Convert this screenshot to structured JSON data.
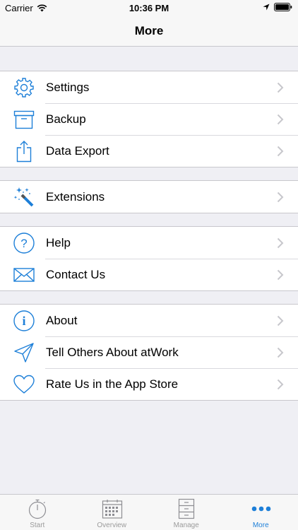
{
  "status_bar": {
    "carrier": "Carrier",
    "time": "10:36 PM"
  },
  "nav": {
    "title": "More"
  },
  "groups": [
    {
      "items": [
        {
          "label": "Settings",
          "icon": "gear-icon"
        },
        {
          "label": "Backup",
          "icon": "archive-box-icon"
        },
        {
          "label": "Data Export",
          "icon": "share-icon"
        }
      ]
    },
    {
      "items": [
        {
          "label": "Extensions",
          "icon": "magic-wand-icon"
        }
      ]
    },
    {
      "items": [
        {
          "label": "Help",
          "icon": "question-icon"
        },
        {
          "label": "Contact Us",
          "icon": "envelope-icon"
        }
      ]
    },
    {
      "items": [
        {
          "label": "About",
          "icon": "info-icon"
        },
        {
          "label": "Tell Others About atWork",
          "icon": "paper-plane-icon"
        },
        {
          "label": "Rate Us in the App Store",
          "icon": "heart-icon"
        }
      ]
    }
  ],
  "tabs": [
    {
      "label": "Start",
      "icon": "stopwatch-icon",
      "active": false
    },
    {
      "label": "Overview",
      "icon": "calendar-icon",
      "active": false
    },
    {
      "label": "Manage",
      "icon": "cabinet-icon",
      "active": false
    },
    {
      "label": "More",
      "icon": "more-dots-icon",
      "active": true
    }
  ],
  "colors": {
    "accent": "#1d7fd8",
    "background": "#efeff4",
    "inactive_tab": "#9b9b9b"
  }
}
